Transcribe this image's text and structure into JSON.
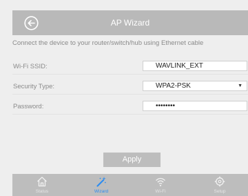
{
  "header": {
    "title": "AP Wizard",
    "back_icon": "back-arrow-circle-icon"
  },
  "instruction": "Connect the device to your router/switch/hub using Ethernet cable",
  "form": {
    "ssid_label": "Wi-Fi SSID:",
    "ssid_value": "WAVLINK_EXT",
    "security_label": "Security Type:",
    "security_value": "WPA2-PSK",
    "password_label": "Password:",
    "password_value": "••••••••"
  },
  "apply_label": "Apply",
  "nav": {
    "items": [
      {
        "label": "Status",
        "icon": "home-icon"
      },
      {
        "label": "Wizard",
        "icon": "wand-icon"
      },
      {
        "label": "Wi-Fi",
        "icon": "wifi-icon"
      },
      {
        "label": "Setup",
        "icon": "gear-icon"
      }
    ],
    "active": "Wizard",
    "active_color": "#2e8df0"
  }
}
